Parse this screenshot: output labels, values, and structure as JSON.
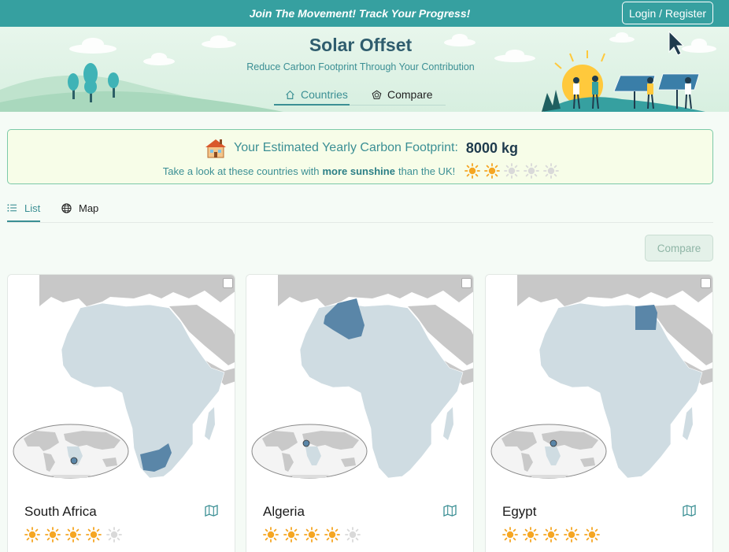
{
  "topbar": {
    "tagline": "Join The Movement! Track Your Progress!",
    "login_label": "Login / Register"
  },
  "hero": {
    "title": "Solar Offset",
    "subtitle": "Reduce Carbon Footprint Through Your Contribution"
  },
  "nav": {
    "countries_label": "Countries",
    "compare_label": "Compare",
    "active": "Countries"
  },
  "footprint": {
    "label": "Your Estimated Yearly Carbon Footprint:",
    "value": "8000 kg",
    "hint_before": "Take a look at these countries with",
    "hint_bold": "more sunshine",
    "hint_after": "than the UK!",
    "uk_sunshine_rating": 2,
    "rating_max": 5
  },
  "view_tabs": {
    "list_label": "List",
    "map_label": "Map",
    "active": "List"
  },
  "compare_button": {
    "label": "Compare",
    "disabled": true
  },
  "countries": [
    {
      "name": "South Africa",
      "sunshine_rating": 4,
      "selected": false
    },
    {
      "name": "Algeria",
      "sunshine_rating": 4,
      "selected": false
    },
    {
      "name": "Egypt",
      "sunshine_rating": 5,
      "selected": false
    }
  ],
  "colors": {
    "accent": "#36a0a0",
    "sun_active": "#f5a623",
    "sun_inactive": "#d9d9d9",
    "highlight_country": "#5a86a8",
    "map_land": "#cfdce2"
  },
  "icons": {
    "login": "none",
    "countries_tab": "home-icon",
    "compare_tab": "pentagon-icon",
    "list_tab": "list-icon",
    "map_tab": "globe-icon",
    "house": "house-icon",
    "detail": "map-book-icon",
    "sun": "sun-icon"
  }
}
